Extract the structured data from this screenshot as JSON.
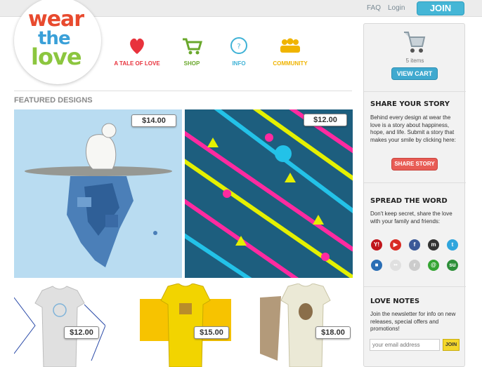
{
  "header": {
    "faq": "FAQ",
    "login": "Login",
    "join": "JOIN",
    "logo_lines": [
      "wear",
      "the",
      "love"
    ]
  },
  "nav": [
    {
      "label": "A TALE of LOVE",
      "icon": "heart-icon",
      "color": "#e8323c"
    },
    {
      "label": "SHOP",
      "icon": "cart-icon",
      "color": "#6aa82c"
    },
    {
      "label": "INFO",
      "icon": "info-icon",
      "color": "#3fb2d6"
    },
    {
      "label": "COMMUNITY",
      "icon": "people-icon",
      "color": "#f0b400"
    }
  ],
  "featured": {
    "title": "FEATURED DESIGNS",
    "designs": [
      {
        "price": "$14.00",
        "name": "polar-bear-iceberg"
      },
      {
        "price": "$12.00",
        "name": "pattern-tribal"
      }
    ],
    "tees": [
      {
        "price": "$12.00",
        "color": "#e0e0e0"
      },
      {
        "price": "$15.00",
        "color": "#f2d400"
      },
      {
        "price": "$18.00",
        "color": "#ebe9d6"
      }
    ]
  },
  "sidebar": {
    "cart": {
      "count": "5 items",
      "button": "VIEW CART"
    },
    "story": {
      "title": "SHARE YOUR STORY",
      "text": "Behind every design at wear the love is a story about happiness, hope, and life. Submit a story that makes your smile by clicking here:",
      "button": "SHARE STORY"
    },
    "spread": {
      "title": "SPREAD THE WORD",
      "text": "Don't keep secret, share the love with your family and friends:",
      "icons": [
        {
          "name": "yahoo-icon",
          "glyph": "Y!",
          "color": "#c0161c"
        },
        {
          "name": "youtube-icon",
          "glyph": "▶",
          "color": "#d92c24"
        },
        {
          "name": "facebook-icon",
          "glyph": "f",
          "color": "#3b5998"
        },
        {
          "name": "myspace-icon",
          "glyph": "m",
          "color": "#333333"
        },
        {
          "name": "twitter-icon",
          "glyph": "t",
          "color": "#2fa5dd"
        },
        {
          "name": "delicious-icon",
          "glyph": "■",
          "color": "#2a6eb5"
        },
        {
          "name": "flickr-icon",
          "glyph": "••",
          "color": "#e0e0e0"
        },
        {
          "name": "reddit-icon",
          "glyph": "r",
          "color": "#cccccc"
        },
        {
          "name": "technorati-icon",
          "glyph": "@",
          "color": "#35a533"
        },
        {
          "name": "stumbleupon-icon",
          "glyph": "su",
          "color": "#2e8f3a"
        }
      ]
    },
    "notes": {
      "title": "LOVE NOTES",
      "text": "Join the newsletter for info on new releases, special offers and promotions!",
      "placeholder": "your email address",
      "button": "JOIN"
    }
  }
}
